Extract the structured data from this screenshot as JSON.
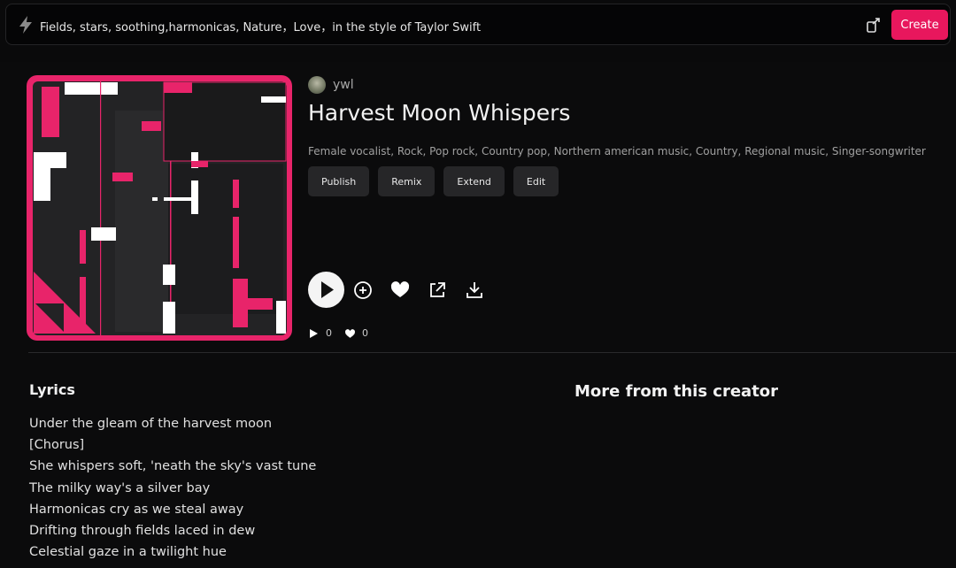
{
  "topbar": {
    "prompt": "Fields, stars, soothing,harmonicas, Nature，Love，in the style of Taylor Swift",
    "create_label": "Create",
    "icons": [
      "bolt-icon",
      "share-icon"
    ]
  },
  "colors": {
    "accent": "#e8175d",
    "background": "#0b0b0c",
    "button": "#262628"
  },
  "song": {
    "creator": "ywl",
    "title": "Harvest Moon Whispers",
    "tags": "Female vocalist, Rock, Pop rock, Country pop, Northern american music, Country, Regional music, Singer-songwriter",
    "actions": [
      "Publish",
      "Remix",
      "Extend",
      "Edit"
    ],
    "play_count": "0",
    "like_count": "0"
  },
  "lyrics": {
    "heading": "Lyrics",
    "lines": [
      "Under the gleam of the harvest moon",
      "[Chorus]",
      "She whispers soft, 'neath the sky's vast tune",
      "The milky way's a silver bay",
      "Harmonicas cry as we steal away",
      "Drifting through fields laced in dew",
      "Celestial gaze in a twilight hue"
    ]
  },
  "more": {
    "heading": "More from this creator"
  }
}
